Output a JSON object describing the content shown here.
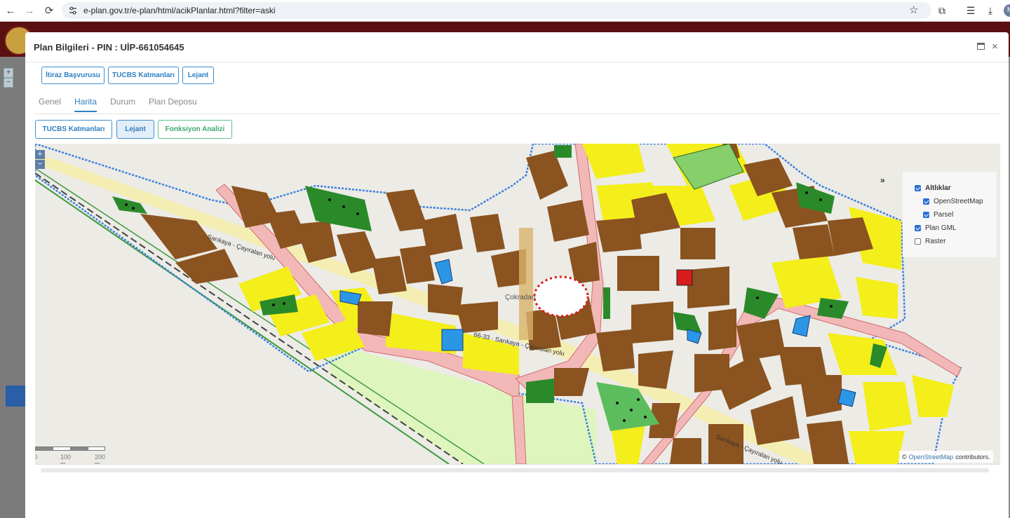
{
  "browser": {
    "url": "e-plan.gov.tr/e-plan/html/acikPlanlar.html?filter=aski",
    "profile_initial": "M"
  },
  "modal": {
    "title": "Plan Bilgileri - PIN : UİP-661054645",
    "top_buttons": [
      "İtiraz Başvurusu",
      "TUCBS Katmanları",
      "Lejant"
    ],
    "tabs": [
      "Genel",
      "Harita",
      "Durum",
      "Plan Deposu"
    ],
    "active_tab": "Harita",
    "map_buttons": [
      "TUCBS Katmanları",
      "Lejant",
      "Fonksiyon Analizi"
    ]
  },
  "map": {
    "zoom_in": "+",
    "zoom_out": "−",
    "panel_toggle": "»",
    "layers": {
      "group_base": "Altlıklar",
      "osm": "OpenStreetMap",
      "parsel": "Parsel",
      "plan_gml": "Plan GML",
      "raster": "Raster"
    },
    "layer_state": {
      "group_base": true,
      "osm": true,
      "parsel": true,
      "plan_gml": true,
      "raster": false
    },
    "labels": {
      "road1": "Sarıkaya - Çayıralan yolu",
      "road2": "66-33 · Sarıkaya - Çayıralan yolu",
      "road3": "Sarıkaya - Çayıralan yolu",
      "village": "Çokradan"
    },
    "scale": {
      "l0": "0",
      "l100": "100 m",
      "l200": "200 m"
    },
    "attribution": {
      "prefix": "©",
      "link": "OpenStreetMap",
      "suffix": "contributors."
    },
    "colors": {
      "residential": "#8a5320",
      "housing_yellow": "#f4ee1a",
      "park_green": "#2a8a2a",
      "light_green": "#dff5be",
      "road_pink": "#f2b8b8",
      "plan_boundary": "#3a7fe0"
    }
  }
}
